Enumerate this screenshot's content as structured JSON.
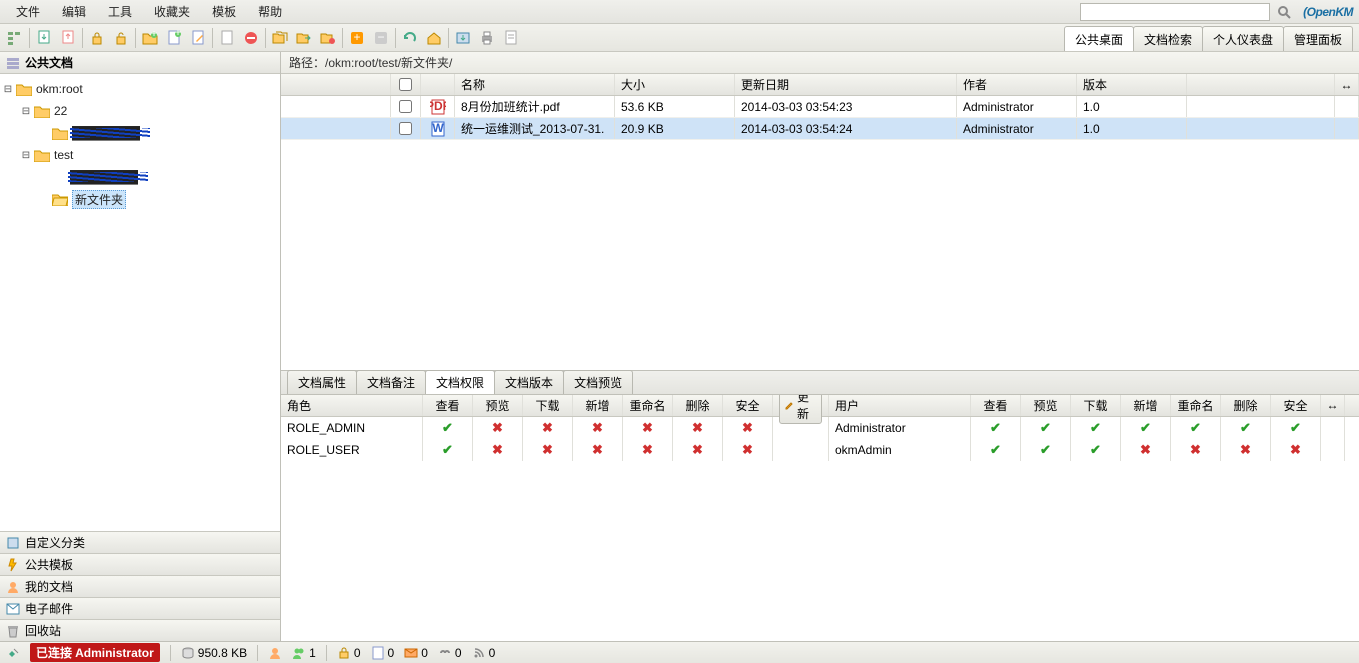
{
  "menu": {
    "file": "文件",
    "edit": "编辑",
    "tools": "工具",
    "bookmarks": "收藏夹",
    "templates": "模板",
    "help": "帮助"
  },
  "logo": "OpenKM",
  "search": {
    "placeholder": ""
  },
  "view_tabs": {
    "public_desktop": "公共桌面",
    "doc_search": "文档检索",
    "personal_dash": "个人仪表盘",
    "admin_panel": "管理面板"
  },
  "sidebar": {
    "public_docs": "公共文档",
    "tree": {
      "root": "okm:root",
      "n22": "22",
      "n22_child": "████████",
      "test": "test",
      "test_child": "████████",
      "newfolder": "新文件夹"
    },
    "panels": {
      "custom_cat": "自定义分类",
      "pub_tmpl": "公共模板",
      "my_docs": "我的文档",
      "email": "电子邮件",
      "trash": "回收站"
    }
  },
  "breadcrumb": {
    "label": "路径：",
    "path": "/okm:root/test/新文件夹/"
  },
  "file_cols": {
    "name": "名称",
    "size": "大小",
    "date": "更新日期",
    "author": "作者",
    "version": "版本"
  },
  "files": [
    {
      "name": "8月份加班统计.pdf",
      "size": "53.6 KB",
      "date": "2014-03-03 03:54:23",
      "author": "Administrator",
      "version": "1.0",
      "type": "pdf"
    },
    {
      "name": "统一运维测试_2013-07-31.",
      "size": "20.9 KB",
      "date": "2014-03-03 03:54:24",
      "author": "Administrator",
      "version": "1.0",
      "type": "doc"
    }
  ],
  "detail_tabs": {
    "props": "文档属性",
    "notes": "文档备注",
    "perms": "文档权限",
    "versions": "文档版本",
    "preview": "文档预览"
  },
  "perm": {
    "role_col": "角色",
    "view": "查看",
    "preview": "预览",
    "download": "下载",
    "add": "新增",
    "rename": "重命名",
    "delete": "删除",
    "security": "安全",
    "update": "更新",
    "user_col": "用户",
    "roles": [
      {
        "name": "ROLE_ADMIN",
        "view": true,
        "preview": false,
        "download": false,
        "add": false,
        "rename": false,
        "delete": false,
        "security": false
      },
      {
        "name": "ROLE_USER",
        "view": true,
        "preview": false,
        "download": false,
        "add": false,
        "rename": false,
        "delete": false,
        "security": false
      }
    ],
    "users": [
      {
        "name": "Administrator",
        "view": true,
        "preview": true,
        "download": true,
        "add": true,
        "rename": true,
        "delete": true,
        "security": true
      },
      {
        "name": "okmAdmin",
        "view": true,
        "preview": true,
        "download": true,
        "add": false,
        "rename": false,
        "delete": false,
        "security": false
      }
    ]
  },
  "status": {
    "connected_label": "已连接",
    "user": "Administrator",
    "disk": "950.8 KB",
    "counts": {
      "users": "1",
      "locked": "0",
      "checked": "0",
      "new": "0",
      "shared": "0",
      "sub": "0"
    }
  }
}
